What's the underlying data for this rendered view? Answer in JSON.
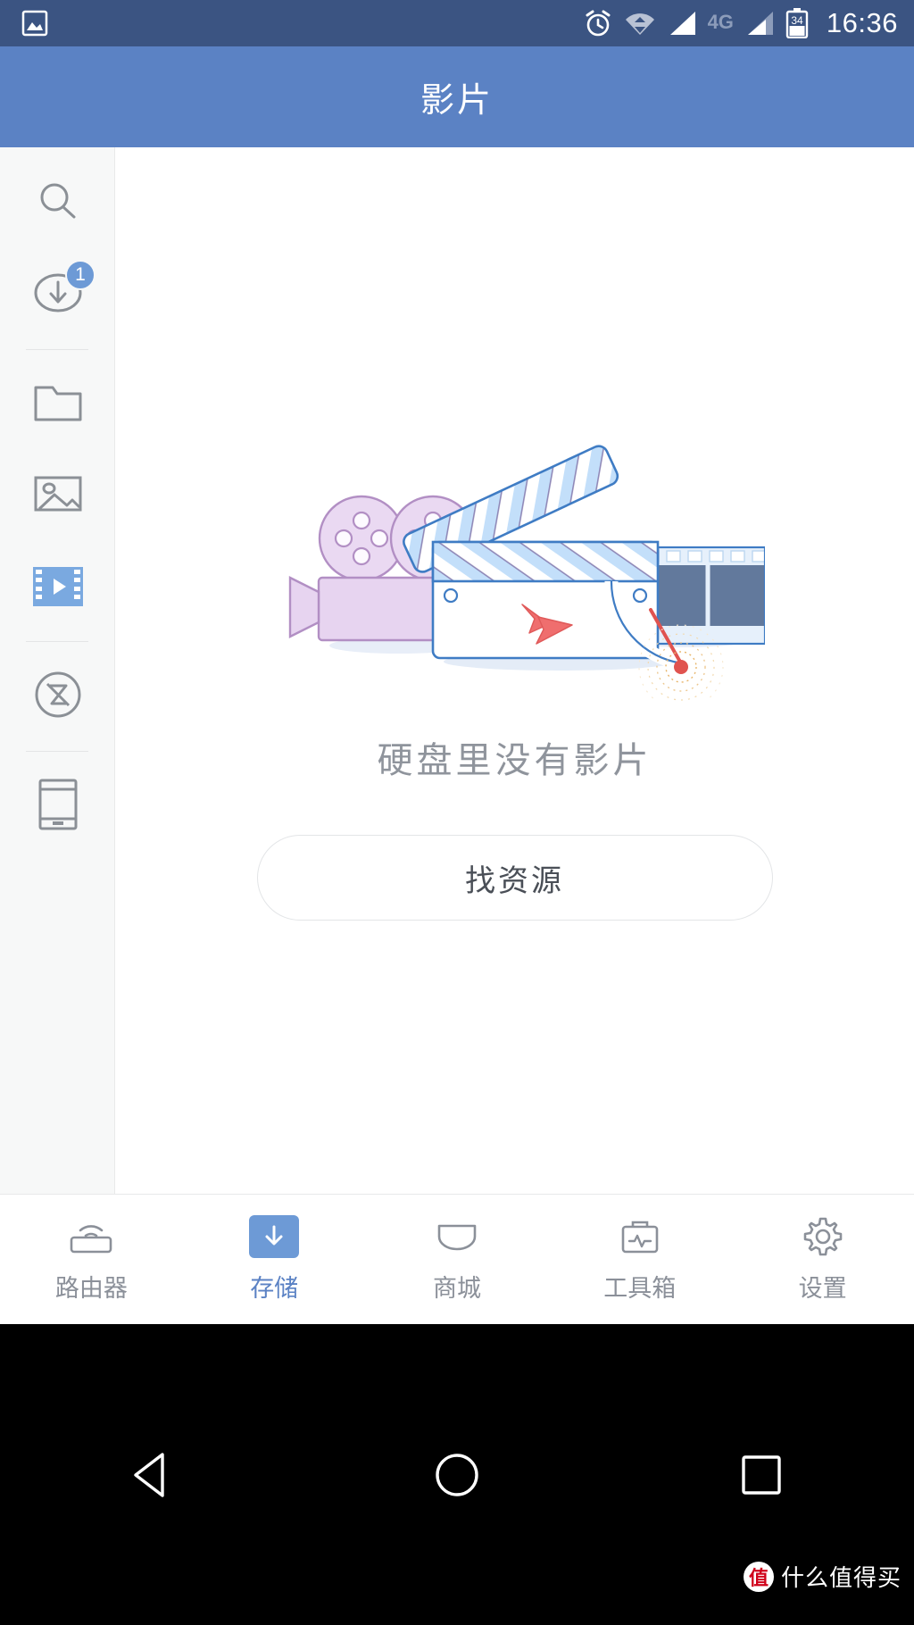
{
  "status_bar": {
    "time": "16:36",
    "network_label": "4G",
    "battery_level": "34",
    "icons": [
      "screenshot-icon",
      "alarm-icon",
      "wifi-icon",
      "signal-icon",
      "signal-icon-2",
      "battery-icon"
    ],
    "background_color": "#3b5482"
  },
  "app_bar": {
    "title": "影片",
    "background_color": "#5b82c4"
  },
  "sidebar": {
    "items": [
      {
        "name": "search",
        "icon": "search-icon",
        "active": false,
        "badge": null
      },
      {
        "name": "downloads",
        "icon": "download-circle-icon",
        "active": false,
        "badge": "1"
      },
      {
        "name": "files",
        "icon": "folder-icon",
        "active": false,
        "badge": null
      },
      {
        "name": "photos",
        "icon": "image-icon",
        "active": false,
        "badge": null
      },
      {
        "name": "videos",
        "icon": "film-play-icon",
        "active": true,
        "badge": null
      },
      {
        "name": "music-off",
        "icon": "music-off-circle-icon",
        "active": false,
        "badge": null
      },
      {
        "name": "device",
        "icon": "mobile-device-icon",
        "active": false,
        "badge": null
      }
    ],
    "accent_color": "#7aa9e0"
  },
  "main": {
    "illustration": "empty-movies-illustration",
    "empty_text": "硬盘里没有影片",
    "button_label": "找资源"
  },
  "tab_bar": {
    "items": [
      {
        "label": "路由器",
        "icon": "router-icon",
        "active": false
      },
      {
        "label": "存储",
        "icon": "storage-download-icon",
        "active": true
      },
      {
        "label": "商城",
        "icon": "shop-icon",
        "active": false
      },
      {
        "label": "工具箱",
        "icon": "toolbox-icon",
        "active": false
      },
      {
        "label": "设置",
        "icon": "gear-icon",
        "active": false
      }
    ],
    "active_color": "#5b82c4",
    "inactive_color": "#8b9099"
  },
  "nav_bar": {
    "buttons": [
      "back-triangle-icon",
      "home-circle-icon",
      "recents-square-icon"
    ],
    "watermark_mark": "值",
    "watermark_text": "什么值得买"
  }
}
